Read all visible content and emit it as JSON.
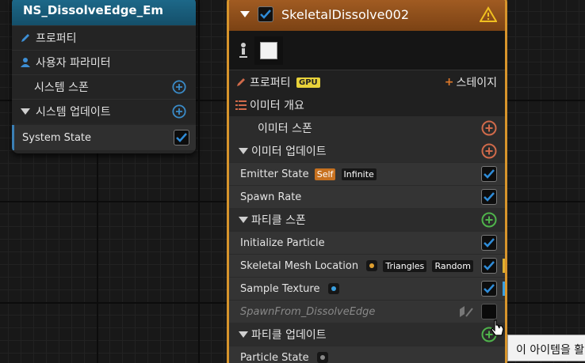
{
  "system_node": {
    "title": "NS_DissolveEdge_Em",
    "rows": [
      {
        "label": "프로퍼티",
        "icon": "pencil-icon"
      },
      {
        "label": "사용자 파라미터",
        "icon": "user-icon"
      },
      {
        "label": "시스템 스폰",
        "icon": "add-icon"
      },
      {
        "label": "시스템 업데이트",
        "icon": "add-icon"
      }
    ],
    "state_label": "System State"
  },
  "emitter_node": {
    "title": "SkeletalDissolve002",
    "warning_icon": "warning-icon",
    "properties_label": "프로퍼티",
    "gpu_badge": "GPU",
    "stage_label": "스테이지",
    "summary_label": "이미터 개요",
    "emitter_spawn": "이미터 스폰",
    "emitter_update": "이미터 업데이트",
    "emitter_state": {
      "label": "Emitter State",
      "badge_self": "Self",
      "badge_infinite": "Infinite"
    },
    "spawn_rate": "Spawn Rate",
    "particle_spawn": "파티클 스폰",
    "initialize_particle": "Initialize Particle",
    "skeletal_mesh_location": {
      "label": "Skeletal Mesh Location",
      "badge_triangles": "Triangles",
      "badge_random": "Random"
    },
    "sample_texture": "Sample Texture",
    "spawn_from": "SpawnFrom_DissolveEdge",
    "particle_update": "파티클 업데이트",
    "particle_state": "Particle State"
  },
  "tooltip": {
    "text": "이 아이템을 활"
  },
  "colors": {
    "accent_orange": "#d7942b",
    "system_title": "#1e6b8c",
    "check_blue": "#2f8cd8",
    "add_blue": "#3a8bc8",
    "add_orange": "#d06a4a",
    "add_green": "#4fb34b"
  }
}
